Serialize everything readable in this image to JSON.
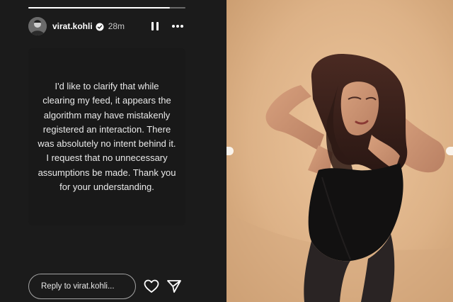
{
  "story": {
    "progress": 0.9,
    "username": "virat.kohli",
    "time": "28m",
    "verified_icon": "verified-badge-icon",
    "pause_icon": "pause-icon",
    "more_icon": "more-options-icon",
    "text_lines": [
      "I'd like to clarify that while",
      "clearing my feed, it appears the",
      "algorithm may have mistakenly",
      "registered an interaction. There",
      "was absolutely no intent behind it.",
      "I request that no unnecessary",
      "assumptions be made. Thank you",
      "for your understanding."
    ],
    "reply_placeholder": "Reply to virat.kohli...",
    "like_icon": "heart-icon",
    "share_icon": "send-icon"
  },
  "photo": {
    "subject": "woman-in-black-bodysuit"
  },
  "colors": {
    "story_bg": "#1b1b1b",
    "card_bg": "#191919",
    "text": "#eaeaea",
    "photo_bg": "#e0b78f"
  }
}
